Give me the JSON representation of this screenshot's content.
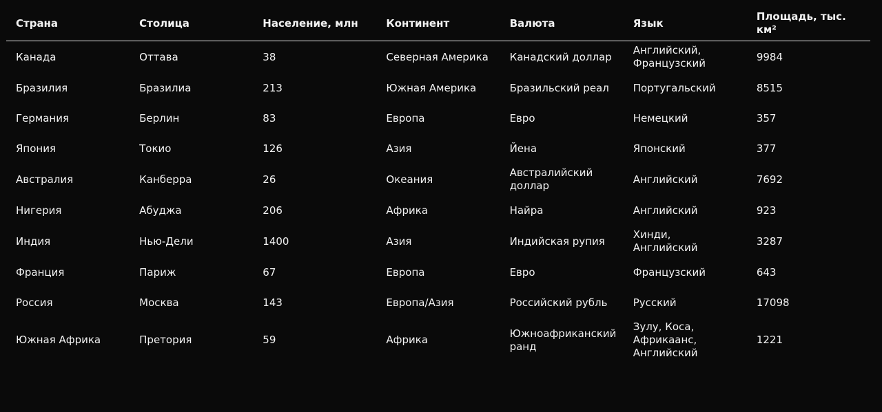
{
  "table": {
    "headers": [
      "Страна",
      "Столица",
      "Население, млн",
      "Континент",
      "Валюта",
      "Язык",
      "Площадь, тыс. км²"
    ],
    "rows": [
      [
        "Канада",
        "Оттава",
        "38",
        "Северная Америка",
        "Канадский доллар",
        "Английский, Французский",
        "9984"
      ],
      [
        "Бразилия",
        "Бразилиа",
        "213",
        "Южная Америка",
        "Бразильский реал",
        "Португальский",
        "8515"
      ],
      [
        "Германия",
        "Берлин",
        "83",
        "Европа",
        "Евро",
        "Немецкий",
        "357"
      ],
      [
        "Япония",
        "Токио",
        "126",
        "Азия",
        "Йена",
        "Японский",
        "377"
      ],
      [
        "Австралия",
        "Канберра",
        "26",
        "Океания",
        "Австралийский доллар",
        "Английский",
        "7692"
      ],
      [
        "Нигерия",
        "Абуджа",
        "206",
        "Африка",
        "Найра",
        "Английский",
        "923"
      ],
      [
        "Индия",
        "Нью-Дели",
        "1400",
        "Азия",
        "Индийская рупия",
        "Хинди, Английский",
        "3287"
      ],
      [
        "Франция",
        "Париж",
        "67",
        "Европа",
        "Евро",
        "Французский",
        "643"
      ],
      [
        "Россия",
        "Москва",
        "143",
        "Европа/Азия",
        "Российский рубль",
        "Русский",
        "17098"
      ],
      [
        "Южная Африка",
        "Претория",
        "59",
        "Африка",
        "Южноафриканский ранд",
        "Зулу, Коса, Африкаанс, Английский",
        "1221"
      ]
    ]
  }
}
